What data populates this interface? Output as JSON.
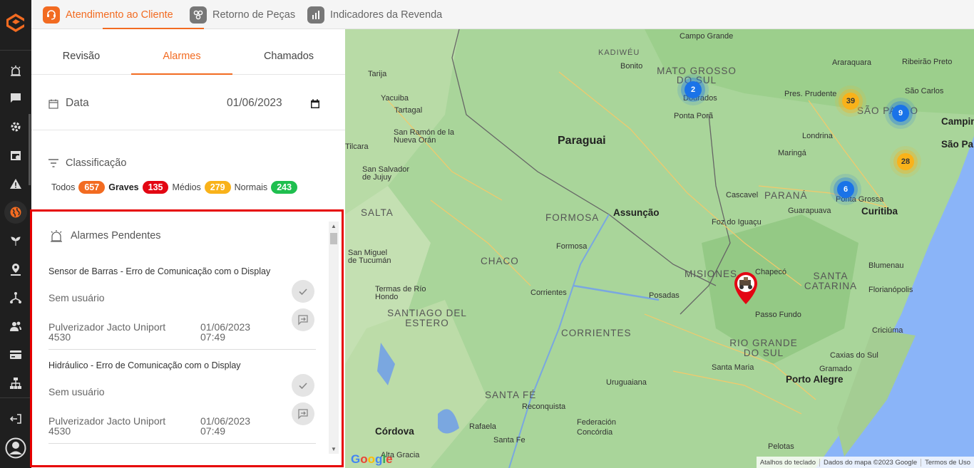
{
  "rail": {
    "items": [
      "alarm-icon",
      "chat-icon",
      "settings-gear-icon",
      "calendar-icon",
      "warning-icon",
      "globe-icon",
      "plant-icon",
      "location-user-icon",
      "network-icon",
      "users-icon",
      "card-icon",
      "org-chart-icon"
    ],
    "bottom": [
      "logout-icon",
      "account-circle-icon"
    ]
  },
  "apps": [
    {
      "label": "Atendimento ao Cliente",
      "active": true
    },
    {
      "label": "Retorno de Peças"
    },
    {
      "label": "Indicadores da Revenda"
    }
  ],
  "subtabs": [
    "Revisão",
    "Alarmes",
    "Chamados"
  ],
  "date": {
    "label": "Data",
    "value": "01/06/2023"
  },
  "classification": {
    "title": "Classificação",
    "filters": [
      {
        "label": "Todos",
        "count": "657",
        "color": "#f26b21"
      },
      {
        "label": "Graves",
        "count": "135",
        "color": "#e30613"
      },
      {
        "label": "Médios",
        "count": "279",
        "color": "#f9b21a"
      },
      {
        "label": "Normais",
        "count": "243",
        "color": "#1fbf4f"
      }
    ]
  },
  "alarms": {
    "title": "Alarmes Pendentes",
    "items": [
      {
        "title": "Sensor de Barras - Erro de Comunicação com o Display",
        "user": "Sem usuário",
        "machine": "Pulverizador Jacto Uniport 4530",
        "date": "01/06/2023",
        "time": "07:49"
      },
      {
        "title": "Hidráulico - Erro de Comunicação com o Display",
        "user": "Sem usuário",
        "machine": "Pulverizador Jacto Uniport 4530",
        "date": "01/06/2023",
        "time": "07:49"
      }
    ]
  },
  "map": {
    "countries": [
      "Paraguai"
    ],
    "regions": [
      "MATO GROSSO DO SUL",
      "PARANÁ",
      "SANTA CATARINA",
      "RIO GRANDE DO SUL",
      "SÃO PAULO",
      "SALTA",
      "FORMOSA",
      "CHACO",
      "MISIONES",
      "SANTIAGO DEL ESTERO",
      "CORRIENTES",
      "SANTA FÉ",
      "KADIWÉU"
    ],
    "cities": [
      "Campo Grande",
      "Bonito",
      "Dourados",
      "Ponta Porã",
      "Araraquara",
      "Ribeirão Preto",
      "Pres. Prudente",
      "São Carlos",
      "Campinas",
      "São Pa",
      "Londrina",
      "Maringá",
      "Cascavel",
      "Ponta Grossa",
      "Guarapuava",
      "Curitiba",
      "Assunção",
      "Foz do Iguaçu",
      "Formosa",
      "Tarija",
      "Yacuiba",
      "Tartagal",
      "San Ramón de la Nueva Orán",
      "Tilcara",
      "San Salvador de Jujuy",
      "San Miguel de Tucumán",
      "Termas de Río Hondo",
      "Corrientes",
      "Posadas",
      "Chapecó",
      "Blumenau",
      "Florianópolis",
      "Passo Fundo",
      "Criciúma",
      "Caxias do Sul",
      "Gramado",
      "Santa Maria",
      "Porto Alegre",
      "Uruguaiana",
      "Reconquista",
      "Rafaela",
      "Santa Fe",
      "Federación",
      "Concórdia",
      "Córdova",
      "Pelotas",
      "Alta Gracia"
    ],
    "clusters": [
      {
        "count": "2",
        "color": "blue"
      },
      {
        "count": "39",
        "color": "yellow"
      },
      {
        "count": "9",
        "color": "blue"
      },
      {
        "count": "28",
        "color": "yellow"
      },
      {
        "count": "6",
        "color": "blue"
      }
    ],
    "attribution": [
      "Atalhos do teclado",
      "Dados do mapa ©2023 Google",
      "Termos de Uso"
    ],
    "google": "Google"
  }
}
